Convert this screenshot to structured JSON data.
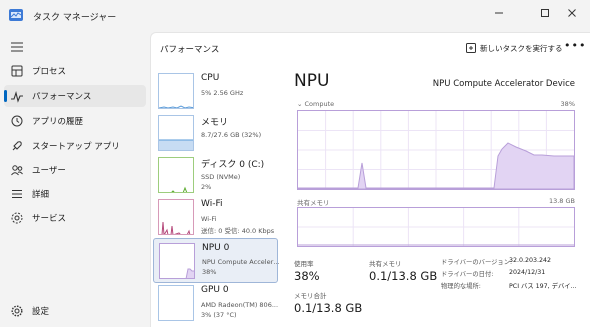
{
  "window": {
    "title": "タスク マネージャー",
    "controls": {
      "minimize": "—",
      "maximize": "□",
      "close": "✕"
    }
  },
  "sidebar": {
    "items": [
      {
        "label": "プロセス",
        "icon": "processes-icon",
        "active": false
      },
      {
        "label": "パフォーマンス",
        "icon": "performance-icon",
        "active": true
      },
      {
        "label": "アプリの履歴",
        "icon": "history-icon",
        "active": false
      },
      {
        "label": "スタートアップ アプリ",
        "icon": "startup-icon",
        "active": false
      },
      {
        "label": "ユーザー",
        "icon": "users-icon",
        "active": false
      },
      {
        "label": "詳細",
        "icon": "details-icon",
        "active": false
      },
      {
        "label": "サービス",
        "icon": "services-icon",
        "active": false
      }
    ],
    "settings_label": "設定"
  },
  "header": {
    "title": "パフォーマンス",
    "run_task_label": "新しいタスクを実行する",
    "more_label": "•••"
  },
  "devices": [
    {
      "name": "CPU",
      "sub1": "5%  2.56 GHz",
      "sub2": "",
      "sub3": ""
    },
    {
      "name": "メモリ",
      "sub1": "8.7/27.6 GB (32%)",
      "sub2": "",
      "sub3": ""
    },
    {
      "name": "ディスク 0 (C:)",
      "sub1": "SSD (NVMe)",
      "sub2": "2%",
      "sub3": ""
    },
    {
      "name": "Wi-Fi",
      "sub1": "Wi-Fi",
      "sub2": "送信: 0  受信: 40.0 Kbps",
      "sub3": ""
    },
    {
      "name": "NPU 0",
      "sub1": "NPU Compute Accelerator Device",
      "sub2": "38%",
      "sub3": ""
    },
    {
      "name": "GPU 0",
      "sub1": "AMD Radeon(TM) 806...",
      "sub2": "3% (37 °C)",
      "sub3": ""
    }
  ],
  "detail": {
    "title": "NPU",
    "device_name": "NPU Compute Accelerator Device",
    "compute_label": "Compute",
    "compute_max": "38%",
    "shared_mem_label": "共有メモリ",
    "shared_mem_max": "13.8 GB",
    "stats": {
      "utilization_label": "使用率",
      "utilization_value": "38%",
      "shared_label": "共有メモリ",
      "shared_value": "0.1/13.8 GB",
      "total_label": "メモリ合計",
      "total_value": "0.1/13.8 GB"
    },
    "info": [
      {
        "key": "ドライバーのバージョン:",
        "value": "32.0.203.242"
      },
      {
        "key": "ドライバーの日付:",
        "value": "2024/12/31"
      },
      {
        "key": "物理的な場所:",
        "value": "PCI バス 197, デバイ..."
      }
    ]
  },
  "colors": {
    "accent": "#0067c0",
    "npu_graph": "#b89fd9",
    "npu_fill": "#e2d4f3",
    "cpu_graph": "#5a9bd8",
    "disk_graph": "#5cab2f",
    "wifi_graph": "#b5487a"
  }
}
